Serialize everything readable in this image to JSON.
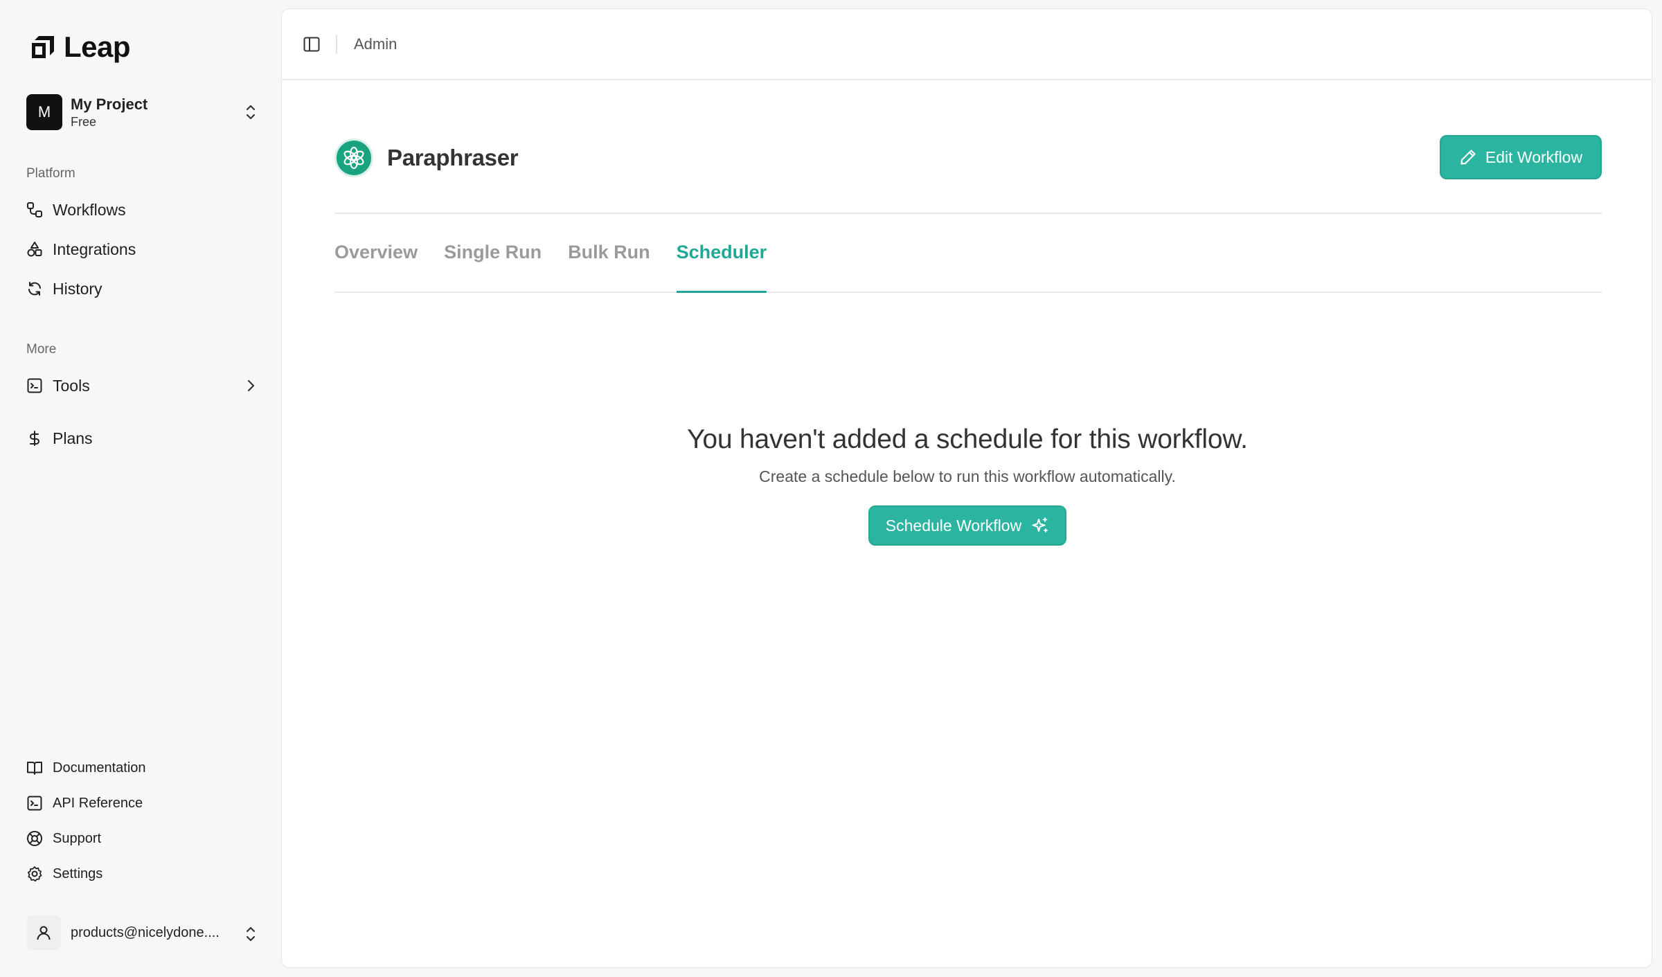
{
  "brand": {
    "name": "Leap"
  },
  "project": {
    "avatar_letter": "M",
    "name": "My Project",
    "plan": "Free"
  },
  "sidebar": {
    "platform_label": "Platform",
    "platform_items": [
      {
        "label": "Workflows",
        "icon": "workflows-icon"
      },
      {
        "label": "Integrations",
        "icon": "integrations-icon"
      },
      {
        "label": "History",
        "icon": "history-icon"
      }
    ],
    "more_label": "More",
    "tools_label": "Tools",
    "plans_label": "Plans",
    "footer_items": [
      {
        "label": "Documentation",
        "icon": "book-icon"
      },
      {
        "label": "API Reference",
        "icon": "terminal-icon"
      },
      {
        "label": "Support",
        "icon": "lifebuoy-icon"
      },
      {
        "label": "Settings",
        "icon": "gear-icon"
      }
    ],
    "user_email": "products@nicelydone...."
  },
  "topbar": {
    "breadcrumb": "Admin"
  },
  "workflow": {
    "title": "Paraphraser",
    "edit_label": "Edit Workflow",
    "tabs": [
      {
        "label": "Overview",
        "active": false
      },
      {
        "label": "Single Run",
        "active": false
      },
      {
        "label": "Bulk Run",
        "active": false
      },
      {
        "label": "Scheduler",
        "active": true
      }
    ]
  },
  "empty_state": {
    "title": "You haven't added a schedule for this workflow.",
    "subtitle": "Create a schedule below to run this workflow automatically.",
    "button_label": "Schedule Workflow"
  },
  "colors": {
    "accent": "#2bb5a0",
    "accent_text": "#1fa896",
    "workflow_icon_bg": "#1aa37f"
  }
}
